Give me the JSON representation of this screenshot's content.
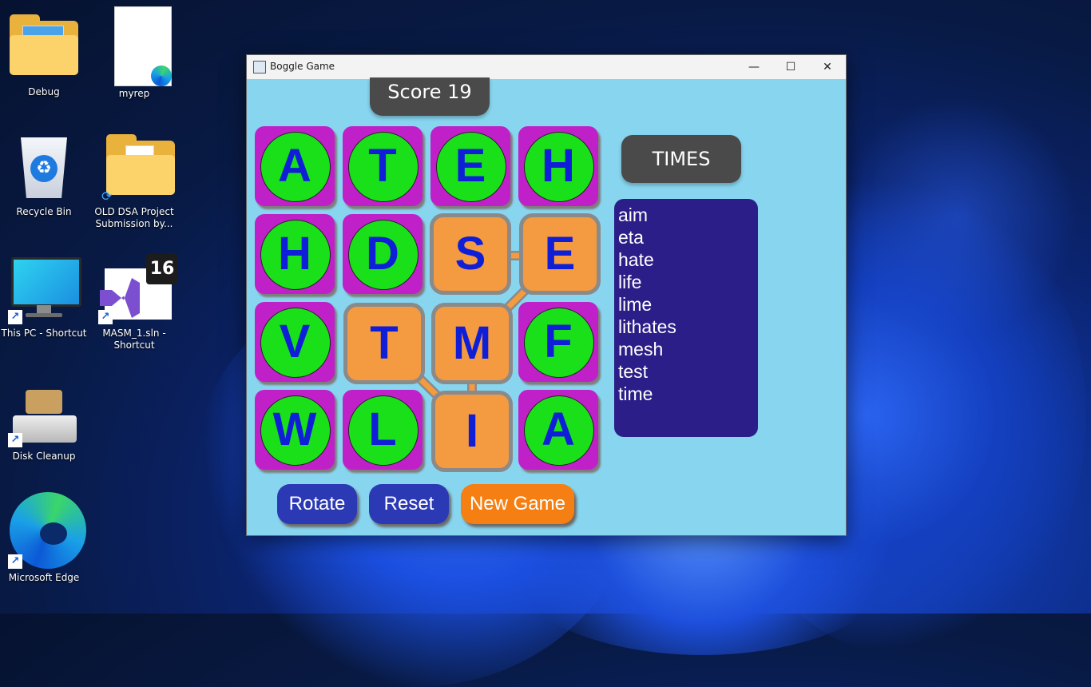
{
  "desktop": {
    "icons": [
      {
        "label": "Debug"
      },
      {
        "label": "myrep"
      },
      {
        "label": "Recycle Bin"
      },
      {
        "label": "OLD DSA Project Submission by..."
      },
      {
        "label": "This PC - Shortcut"
      },
      {
        "label": "MASM_1.sln - Shortcut",
        "badge": "16"
      },
      {
        "label": "Disk Cleanup"
      },
      {
        "label": "Microsoft Edge"
      }
    ],
    "shortcut_arrow": "↗"
  },
  "window": {
    "title": "Boggle Game",
    "controls": {
      "minimize": "—",
      "maximize": "☐",
      "close": "✕"
    }
  },
  "game": {
    "score_label": "Score 19",
    "times_label": "TIMES",
    "grid": [
      [
        "A",
        "T",
        "E",
        "H"
      ],
      [
        "H",
        "D",
        "S",
        "E"
      ],
      [
        "V",
        "T",
        "M",
        "F"
      ],
      [
        "W",
        "L",
        "I",
        "A"
      ]
    ],
    "selected_path_letters": [
      "T",
      "I",
      "M",
      "E",
      "S"
    ],
    "words": [
      "aim",
      "eta",
      "hate",
      "life",
      "lime",
      "lithates",
      "mesh",
      "test",
      "time"
    ],
    "buttons": {
      "rotate": "Rotate",
      "reset": "Reset",
      "new_game": "New Game"
    }
  },
  "colors": {
    "window_bg": "#87d5ef",
    "tile_normal": "#c020c8",
    "tile_circle": "#1ae01a",
    "tile_selected": "#f49a40",
    "letter": "#0f1fd8",
    "word_panel": "#2b1e88",
    "button_blue": "#2c39b5",
    "button_orange": "#f57f12"
  }
}
